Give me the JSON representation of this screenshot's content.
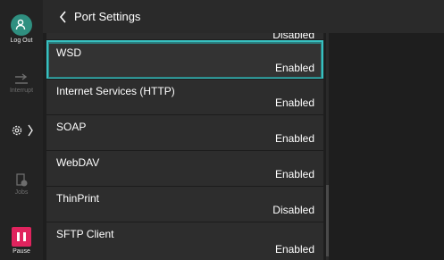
{
  "header": {
    "title": "Port Settings"
  },
  "rail": {
    "logout_label": "Log Out",
    "interrupt_label": "Interrupt",
    "jobs_label": "Jobs",
    "pause_label": "Pause"
  },
  "list": {
    "partial_value": "Disabled",
    "items": [
      {
        "label": "WSD",
        "value": "Enabled"
      },
      {
        "label": "Internet Services (HTTP)",
        "value": "Enabled"
      },
      {
        "label": "SOAP",
        "value": "Enabled"
      },
      {
        "label": "WebDAV",
        "value": "Enabled"
      },
      {
        "label": "ThinPrint",
        "value": "Disabled"
      },
      {
        "label": "SFTP Client",
        "value": "Enabled"
      }
    ]
  },
  "colors": {
    "accent": "#38c0c0",
    "logout": "#2f8f80",
    "pause": "#e0245e"
  }
}
